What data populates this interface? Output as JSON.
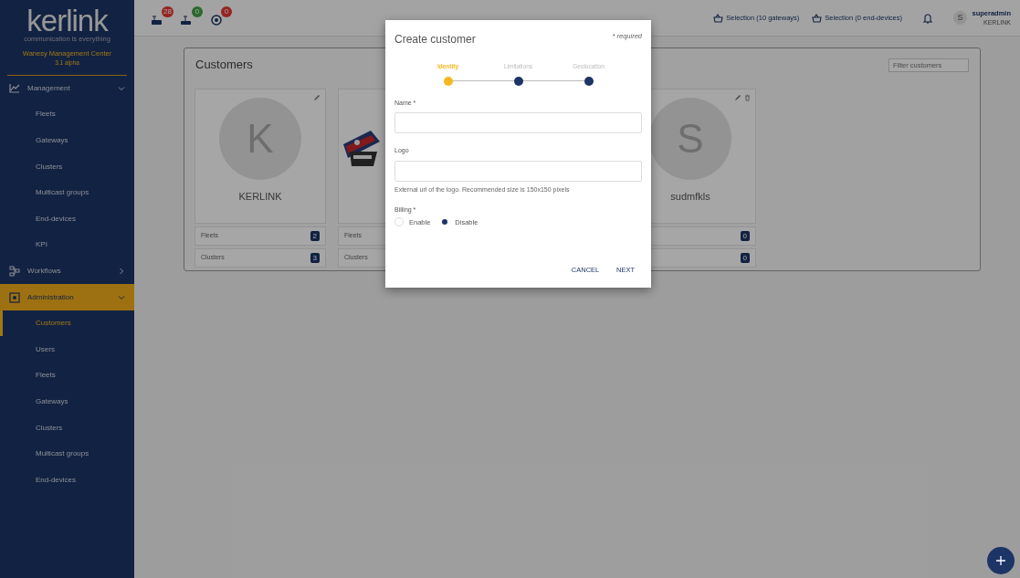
{
  "brand": {
    "logo": "kerlink",
    "tagline": "communication is everything",
    "product": "Wanesy Management Center",
    "version": "3.1 alpha"
  },
  "sidebar": {
    "items": [
      {
        "label": "Management",
        "expanded": true,
        "selected": false,
        "children": [
          {
            "label": "Fleets",
            "selected": false
          },
          {
            "label": "Gateways",
            "selected": false
          },
          {
            "label": "Clusters",
            "selected": false
          },
          {
            "label": "Multicast groups",
            "selected": false
          },
          {
            "label": "End-devices",
            "selected": false
          },
          {
            "label": "KPI",
            "selected": false
          }
        ]
      },
      {
        "label": "Workflows",
        "expanded": false,
        "selected": false
      },
      {
        "label": "Administration",
        "expanded": true,
        "selected": true,
        "children": [
          {
            "label": "Customers",
            "selected": true
          },
          {
            "label": "Users",
            "selected": false
          },
          {
            "label": "Fleets",
            "selected": false
          },
          {
            "label": "Gateways",
            "selected": false
          },
          {
            "label": "Clusters",
            "selected": false
          },
          {
            "label": "Multicast groups",
            "selected": false
          },
          {
            "label": "End-devices",
            "selected": false
          }
        ]
      }
    ]
  },
  "topbar": {
    "alerts": [
      {
        "kind": "gateway",
        "count": "28"
      },
      {
        "kind": "router",
        "count": "0"
      },
      {
        "kind": "device",
        "count": "0"
      }
    ],
    "selections": [
      "Selection (10 gateways)",
      "Selection (0 end-devices)"
    ],
    "user": {
      "initial": "S",
      "name": "superadmin",
      "org": "KERLINK"
    }
  },
  "customers": {
    "title": "Customers",
    "filter": {
      "placeholder": "Filter customers"
    },
    "cards": [
      {
        "kind": "initial",
        "initial": "K",
        "name": "KERLINK",
        "deletable": false,
        "stats": [
          {
            "label": "Fleets",
            "count": "2"
          },
          {
            "label": "Clusters",
            "count": "3"
          }
        ]
      },
      {
        "kind": "logo",
        "stats": [
          {
            "label": "Fleets"
          },
          {
            "label": "Clusters"
          }
        ]
      },
      {
        "kind": "hidden"
      },
      {
        "kind": "initial",
        "initial": "S",
        "name": "sudmfkls",
        "deletable": true,
        "stats": [
          {
            "count": "0"
          },
          {
            "count": "0"
          }
        ]
      }
    ]
  },
  "dialog": {
    "title": "Create customer",
    "note": "* required",
    "steps": [
      {
        "label": "Identity",
        "selected": true
      },
      {
        "label": "Limitations",
        "selected": false
      },
      {
        "label": "Geolocation",
        "selected": false
      }
    ],
    "fields": [
      {
        "label": "Name *"
      },
      {
        "label": "Logo",
        "help": "External url of the logo. Recommended size is 150x150 pixels"
      }
    ],
    "billing": {
      "label": "Billing *",
      "options": [
        {
          "label": "Enable",
          "selected": false
        },
        {
          "label": "Disable",
          "selected": true
        }
      ]
    },
    "buttons": [
      "CANCEL",
      "NEXT"
    ]
  }
}
